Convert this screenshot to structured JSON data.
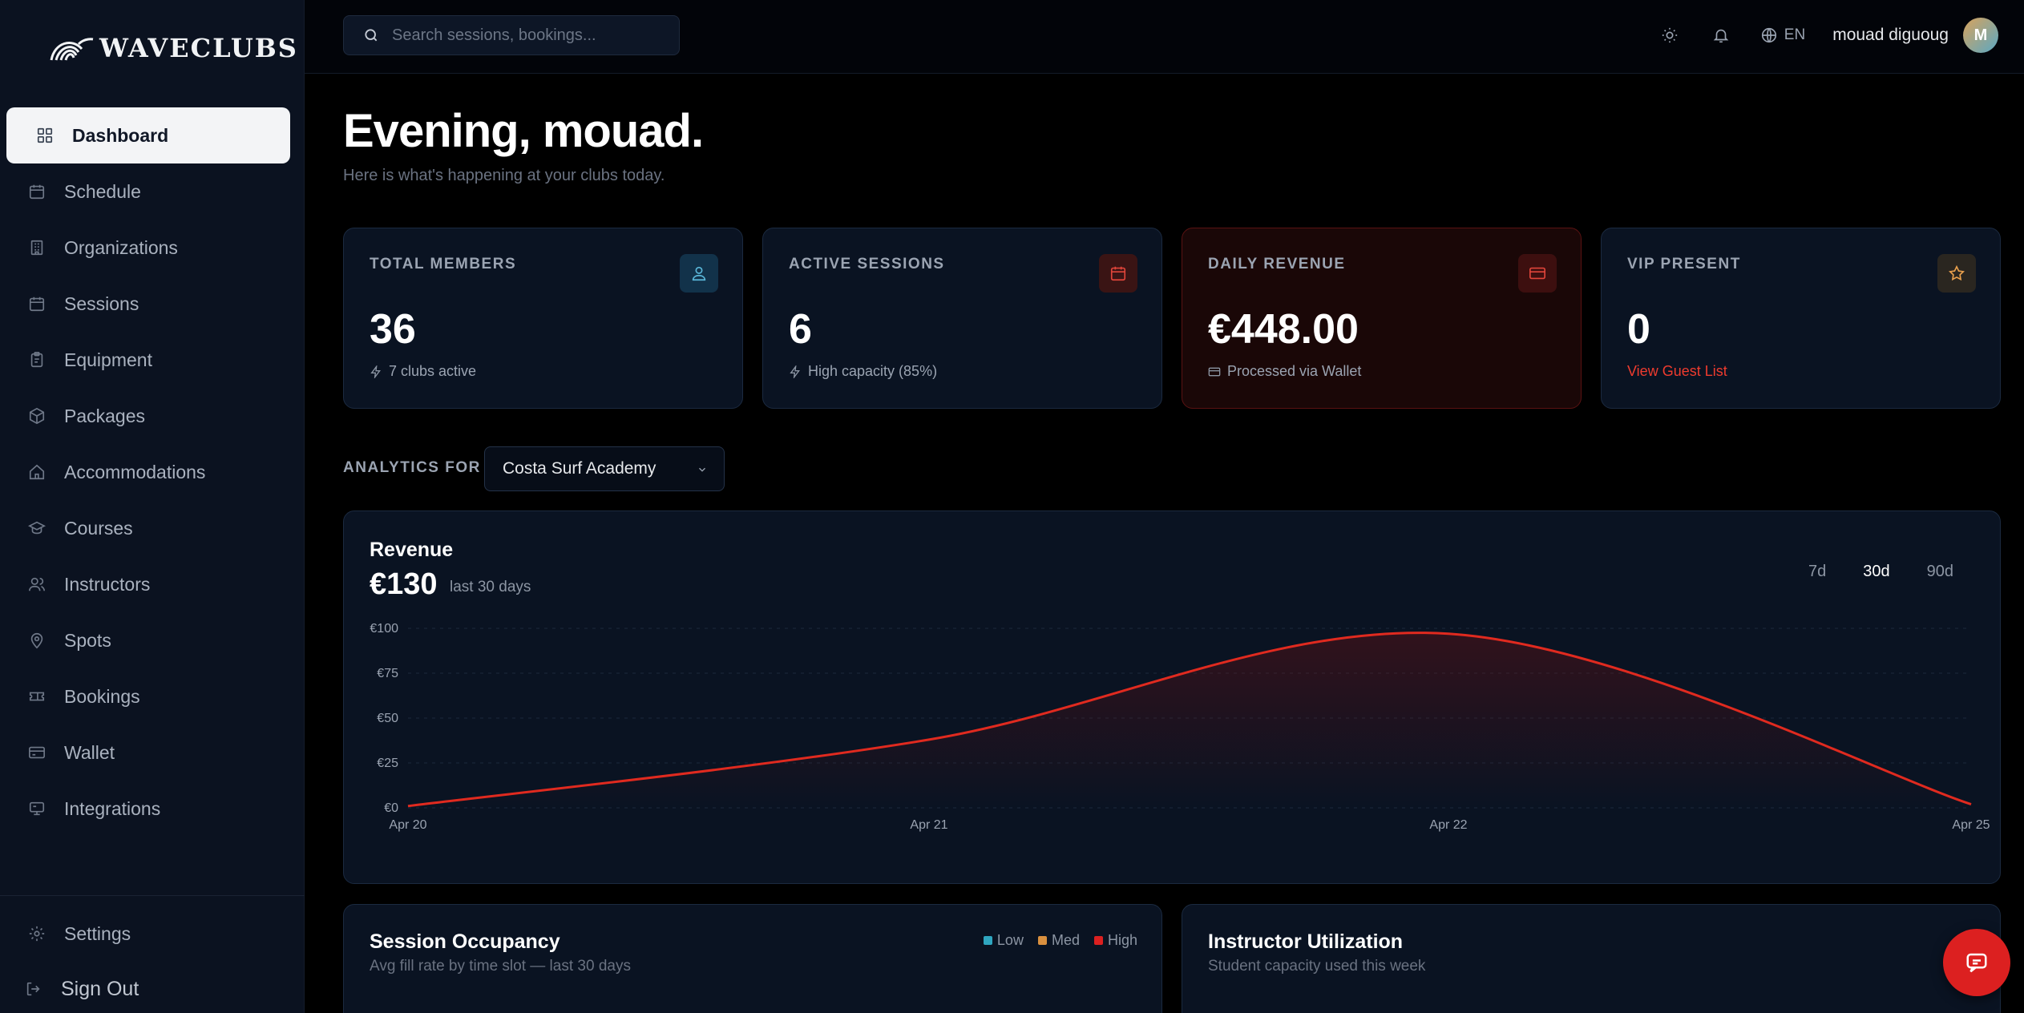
{
  "brand": {
    "name": "WAVECLUBS"
  },
  "sidebar": {
    "items": [
      {
        "label": "Dashboard",
        "icon": "grid-icon",
        "active": true
      },
      {
        "label": "Schedule",
        "icon": "calendar-icon"
      },
      {
        "label": "Organizations",
        "icon": "building-icon"
      },
      {
        "label": "Sessions",
        "icon": "calendar-icon"
      },
      {
        "label": "Equipment",
        "icon": "clipboard-icon"
      },
      {
        "label": "Packages",
        "icon": "package-icon"
      },
      {
        "label": "Accommodations",
        "icon": "home-icon"
      },
      {
        "label": "Courses",
        "icon": "graduation-cap-icon"
      },
      {
        "label": "Instructors",
        "icon": "users-icon"
      },
      {
        "label": "Spots",
        "icon": "map-pin-icon"
      },
      {
        "label": "Bookings",
        "icon": "ticket-icon"
      },
      {
        "label": "Wallet",
        "icon": "credit-card-icon"
      },
      {
        "label": "Integrations",
        "icon": "plug-icon"
      }
    ],
    "settings_label": "Settings",
    "signout_label": "Sign Out"
  },
  "topbar": {
    "search_placeholder": "Search sessions, bookings...",
    "language": "EN",
    "username": "mouad diguoug",
    "avatar_initial": "M"
  },
  "greeting": {
    "title": "Evening, mouad.",
    "subtitle": "Here is what's happening at your clubs today."
  },
  "stats": [
    {
      "label": "TOTAL MEMBERS",
      "value": "36",
      "sub": "7 clubs active",
      "icon": "users-icon"
    },
    {
      "label": "ACTIVE SESSIONS",
      "value": "6",
      "sub": "High capacity (85%)",
      "icon": "calendar-icon"
    },
    {
      "label": "DAILY REVENUE",
      "value": "€448.00",
      "sub": "Processed via Wallet",
      "icon": "credit-card-icon"
    },
    {
      "label": "VIP PRESENT",
      "value": "0",
      "sub": "View Guest List",
      "icon": "star-icon"
    }
  ],
  "analytics": {
    "label": "ANALYTICS FOR",
    "selected_club": "Costa Surf Academy"
  },
  "revenue_panel": {
    "title": "Revenue",
    "total": "€130",
    "period": "last 30 days",
    "ranges": [
      "7d",
      "30d",
      "90d"
    ],
    "active_range": "30d"
  },
  "colors": {
    "accent_red": "#dc2020",
    "line_red": "#e02a1f",
    "low": "#2fa6c0",
    "med": "#d9903f",
    "high": "#dc2020"
  },
  "chart_data": {
    "type": "area",
    "x": [
      "Apr 20",
      "Apr 21",
      "Apr 22",
      "Apr 25"
    ],
    "values": [
      1,
      38,
      97,
      2
    ],
    "title": "Revenue",
    "xlabel": "",
    "ylabel": "",
    "ylim": [
      0,
      100
    ],
    "yticks": [
      "€0",
      "€25",
      "€50",
      "€75",
      "€100"
    ],
    "ytick_values": [
      0,
      25,
      50,
      75,
      100
    ],
    "grid": true
  },
  "occupancy_panel": {
    "title": "Session Occupancy",
    "subtitle": "Avg fill rate by time slot — last 30 days",
    "legend": [
      "Low",
      "Med",
      "High"
    ]
  },
  "utilization_panel": {
    "title": "Instructor Utilization",
    "subtitle": "Student capacity used this week"
  }
}
